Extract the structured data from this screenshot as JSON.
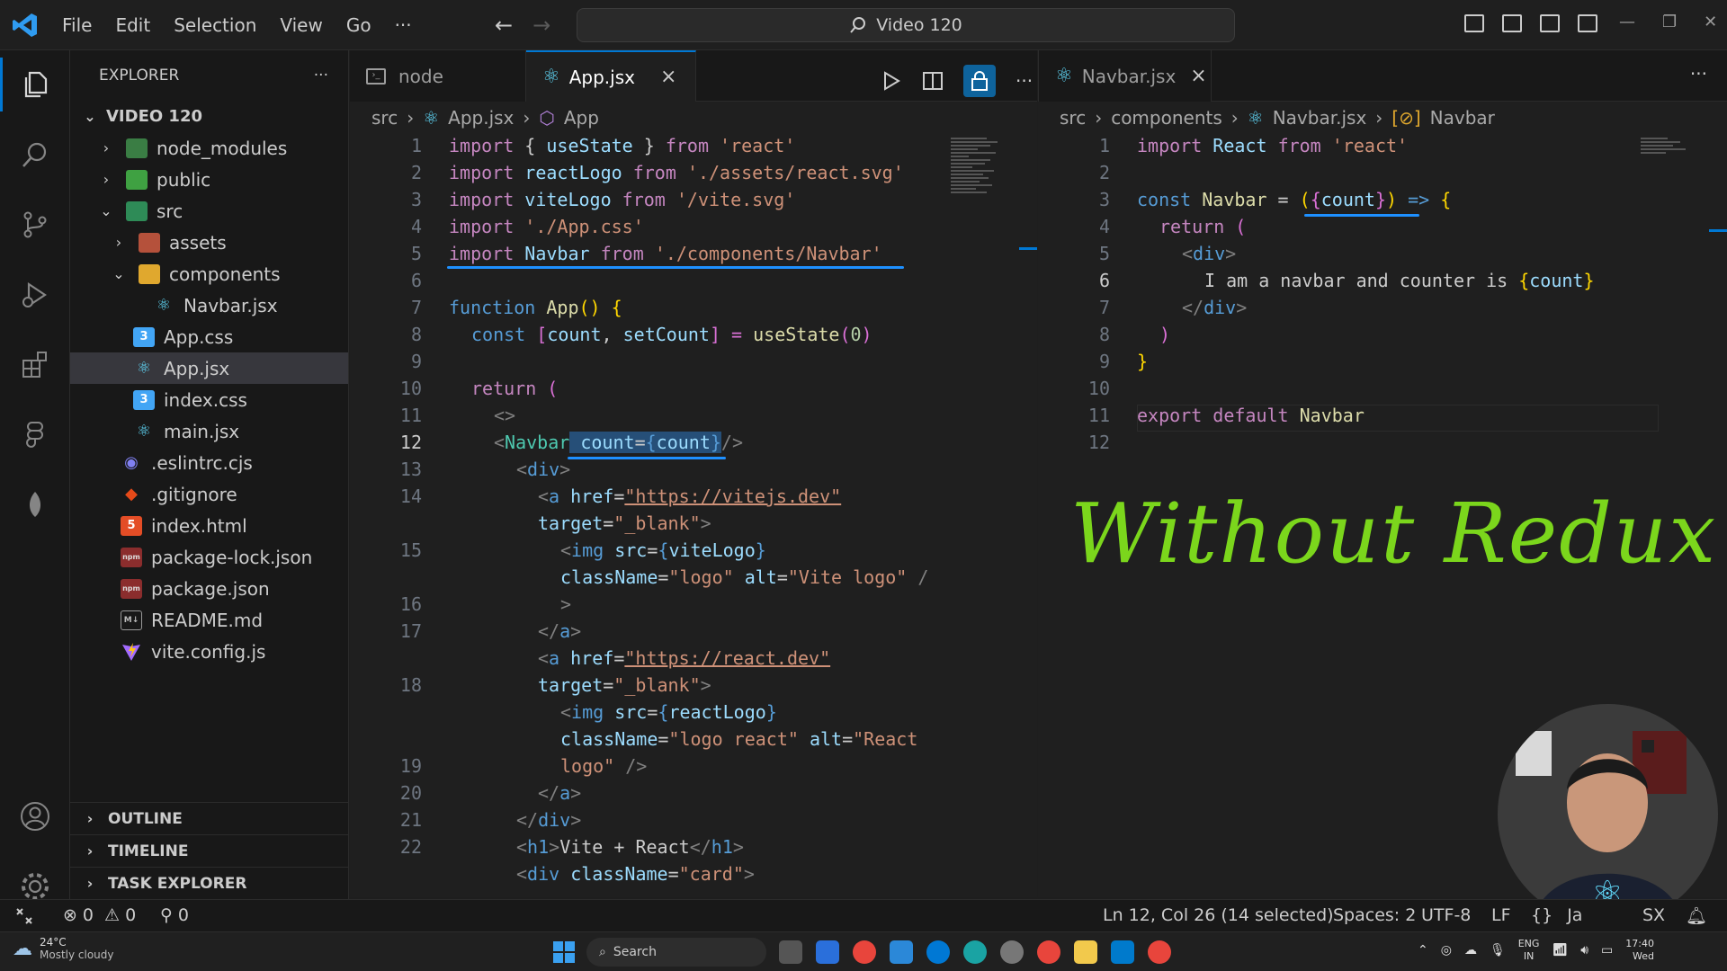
{
  "window": {
    "search_label": "Video 120"
  },
  "menu": [
    "File",
    "Edit",
    "Selection",
    "View",
    "Go",
    "···"
  ],
  "explorer": {
    "header": "EXPLORER",
    "more": "···",
    "root": "VIDEO 120",
    "items": [
      {
        "label": "node_modules",
        "icon": "folder-node-icon"
      },
      {
        "label": "public",
        "icon": "folder-public-icon"
      },
      {
        "label": "src",
        "icon": "folder-src-icon"
      },
      {
        "label": "assets",
        "icon": "folder-assets-icon"
      },
      {
        "label": "components",
        "icon": "folder-components-icon"
      },
      {
        "label": "Navbar.jsx",
        "icon": "react-icon"
      },
      {
        "label": "App.css",
        "icon": "css-icon"
      },
      {
        "label": "App.jsx",
        "icon": "react-icon"
      },
      {
        "label": "index.css",
        "icon": "css-icon"
      },
      {
        "label": "main.jsx",
        "icon": "react-icon"
      },
      {
        "label": ".eslintrc.cjs",
        "icon": "eslint-icon"
      },
      {
        "label": ".gitignore",
        "icon": "git-icon"
      },
      {
        "label": "index.html",
        "icon": "html-icon"
      },
      {
        "label": "package-lock.json",
        "icon": "npm-icon"
      },
      {
        "label": "package.json",
        "icon": "npm-icon"
      },
      {
        "label": "README.md",
        "icon": "markdown-icon"
      },
      {
        "label": "vite.config.js",
        "icon": "vite-icon"
      }
    ],
    "sections": [
      "OUTLINE",
      "TIMELINE",
      "TASK EXPLORER"
    ]
  },
  "left_editor": {
    "tabs": [
      {
        "label": "node"
      },
      {
        "label": "App.jsx"
      }
    ],
    "close": "×",
    "more": "···",
    "breadcrumb": [
      "src",
      "App.jsx",
      "App"
    ],
    "line_numbers": [
      "1",
      "2",
      "3",
      "4",
      "5",
      "6",
      "7",
      "8",
      "9",
      "10",
      "11",
      "12",
      "13",
      "14",
      "",
      "15",
      "",
      "16",
      "17",
      "",
      "18",
      "",
      "",
      "19",
      "20",
      "21",
      "22"
    ],
    "code": {
      "l1": [
        "import",
        " { ",
        "useState",
        " } ",
        "from",
        " ",
        "'react'"
      ],
      "l2": [
        "import",
        " ",
        "reactLogo",
        " ",
        "from",
        " ",
        "'./assets/react.svg'"
      ],
      "l3": [
        "import",
        " ",
        "viteLogo",
        " ",
        "from",
        " ",
        "'/vite.svg'"
      ],
      "l4": [
        "import",
        " ",
        "'./App.css'"
      ],
      "l5": [
        "import",
        " ",
        "Navbar",
        " ",
        "from",
        " ",
        "'./components/Navbar'"
      ],
      "l7": [
        "function",
        " ",
        "App",
        "() {"
      ],
      "l8": [
        "const",
        " [",
        "count",
        ", ",
        "setCount",
        "] = ",
        "useState",
        "(",
        "0",
        ")"
      ],
      "l10": [
        "return",
        " ("
      ],
      "l11": [
        "<>"
      ],
      "l12": [
        "<",
        "Navbar",
        " ",
        "count",
        "=",
        "{",
        "count",
        "}",
        "/>"
      ],
      "l13": [
        "<",
        "div",
        ">"
      ],
      "l14a": [
        "<",
        "a",
        " ",
        "href",
        "=",
        "\"https://vitejs.dev\""
      ],
      "l14b": [
        "target",
        "=",
        "\"_blank\"",
        ">"
      ],
      "l15a": [
        "<",
        "img",
        " ",
        "src",
        "=",
        "{",
        "viteLogo",
        "}"
      ],
      "l15b": [
        "className",
        "=",
        "\"logo\"",
        " ",
        "alt",
        "=",
        "\"Vite logo\"",
        " /"
      ],
      "l15c": [
        ">"
      ],
      "l16": [
        "</",
        "a",
        ">"
      ],
      "l17a": [
        "<",
        "a",
        " ",
        "href",
        "=",
        "\"https://react.dev\""
      ],
      "l17b": [
        "target",
        "=",
        "\"_blank\"",
        ">"
      ],
      "l18a": [
        "<",
        "img",
        " ",
        "src",
        "=",
        "{",
        "reactLogo",
        "}"
      ],
      "l18b": [
        "className",
        "=",
        "\"logo react\"",
        " ",
        "alt",
        "=",
        "\"React"
      ],
      "l18c": [
        "logo\"",
        " />"
      ],
      "l19": [
        "</",
        "a",
        ">"
      ],
      "l20": [
        "</",
        "div",
        ">"
      ],
      "l21": [
        "<",
        "h1",
        ">",
        "Vite + React",
        "</",
        "h1",
        ">"
      ],
      "l22": [
        "<",
        "div",
        " ",
        "className",
        "=",
        "\"card\"",
        ">"
      ]
    }
  },
  "right_editor": {
    "tab": "Navbar.jsx",
    "close": "×",
    "more": "···",
    "breadcrumb": [
      "src",
      "components",
      "Navbar.jsx",
      "Navbar"
    ],
    "line_numbers": [
      "1",
      "2",
      "3",
      "4",
      "5",
      "6",
      "7",
      "8",
      "9",
      "10",
      "11",
      "12"
    ],
    "code": {
      "l1": [
        "import",
        " ",
        "React",
        " ",
        "from",
        " ",
        "'react'"
      ],
      "l3": [
        "const",
        " ",
        "Navbar",
        " = ",
        "(",
        "{",
        "count",
        "}",
        ")",
        " => ",
        "{"
      ],
      "l4": [
        "return",
        " ("
      ],
      "l5": [
        "<",
        "div",
        ">"
      ],
      "l6": [
        "I am a navbar and counter is ",
        "{",
        "count",
        "}"
      ],
      "l7": [
        "</",
        "div",
        ">"
      ],
      "l8": [
        ")"
      ],
      "l9": [
        "}"
      ],
      "l11": [
        "export",
        " ",
        "default",
        " ",
        "Navbar"
      ]
    },
    "annotation": "Without Redux"
  },
  "statusbar": {
    "errors": "0",
    "warnings": "0",
    "ports": "0",
    "position": "Ln 12, Col 26 (14 selected)",
    "spaces": "Spaces: 2",
    "encoding": "UTF-8",
    "eol": "LF",
    "lang_partial": "Ja",
    "jsx_partial": "SX"
  },
  "taskbar": {
    "weather_temp": "24°C",
    "weather_desc": "Mostly cloudy",
    "search": "Search",
    "lang_top": "ENG",
    "lang_bottom": "IN",
    "time": "17:40",
    "day": "Wed"
  },
  "colors": {
    "accent": "#0078d4",
    "annotation_green": "#7bd61c",
    "ink_blue": "#1e90ff"
  }
}
